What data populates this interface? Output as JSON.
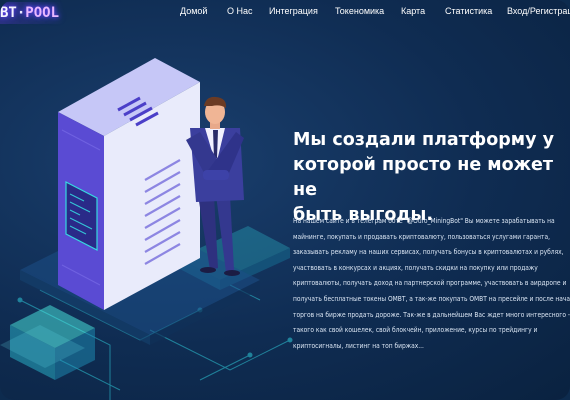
{
  "logo": {
    "left": "BT",
    "sep": "·",
    "right": "POOL"
  },
  "nav": {
    "items": [
      "Домой",
      "О Нас",
      "Интеграция",
      "Токеномика",
      "Карта",
      "Статистика",
      "Вход/Регистрация"
    ]
  },
  "hero": {
    "headline": [
      "Мы создали платформу у",
      "которой просто не может не",
      "быть выгоды."
    ],
    "paragraph": [
      "На нашем сайте и в телеграм боте \"@Ouro_MiningBot\" Вы можете зарабатывать на",
      "майнинге, покупать и продавать криптовалюту, пользоваться услугами гаранта,",
      "заказывать рекламу на наших сервисах, получать бонусы в криптовалютах и рублях,",
      "участвовать в конкурсах и акциях, получать скидки на покупку или продажу",
      "криптовалюты, получать доход на партнерской программе, участвовать в аирдропе и",
      "получать бесплатные токены OMBT, а так-же покупать OMBT на пресейле и после начала",
      "торгов на бирже продать дороже. Так-же в дальнейшем Вас ждет много интересного -",
      "такого как свой кошелек, свой блокчейн, приложение, курсы по трейдингу и",
      "криптосигналы, листинг на топ биржах..."
    ]
  },
  "colors": {
    "background": "#0f2c52",
    "server_front": "#e9ecfb",
    "server_side": "#5b4fd6",
    "accent_cyan": "#41e0d6",
    "suit": "#3b3f9e"
  },
  "icons": {
    "server": "server-rack-illustration",
    "person": "businessman-illustration",
    "platform": "isometric-platform"
  }
}
